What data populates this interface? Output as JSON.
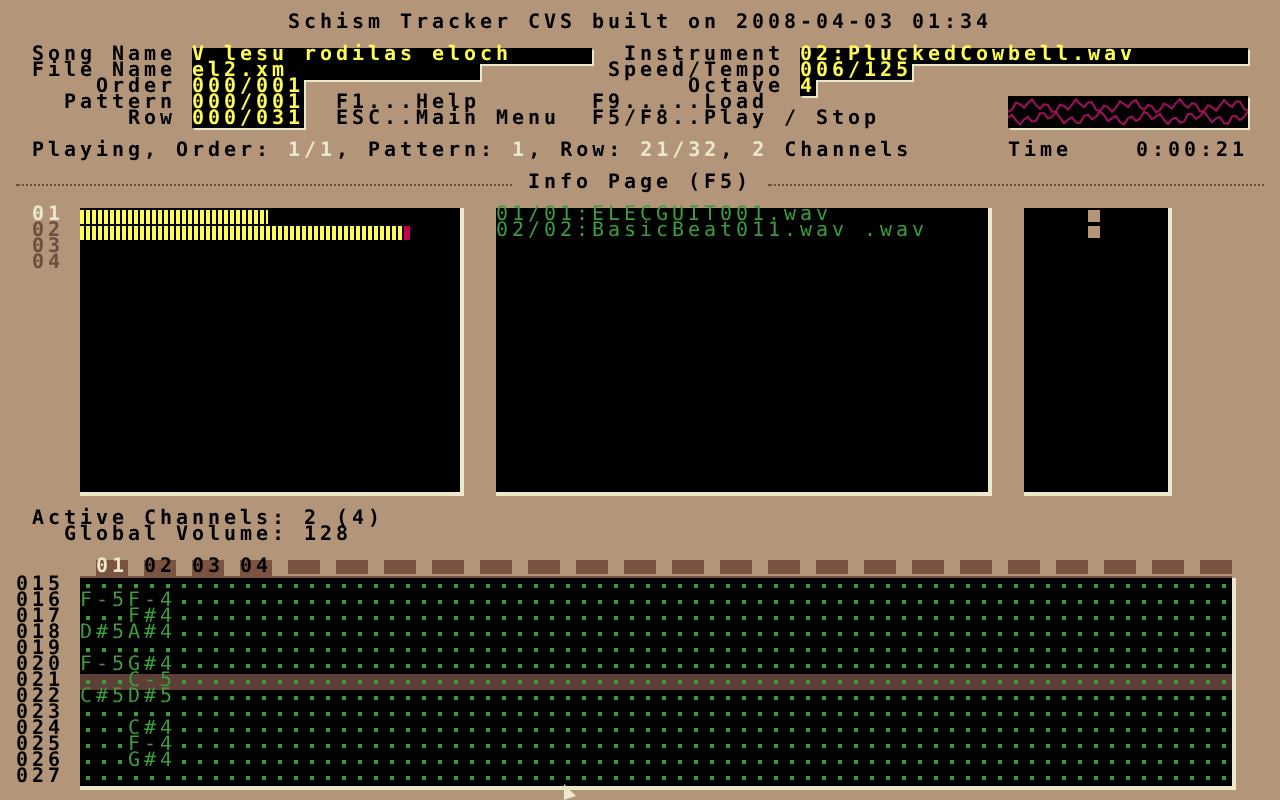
{
  "title": "Schism Tracker CVS built on 2008-04-03 01:34",
  "song_fields": [
    {
      "label": "Song Name",
      "value": "V lesu rodilas eloch"
    },
    {
      "label": "File Name",
      "value": "el2.xm"
    },
    {
      "label": "Order",
      "value": "000/001"
    },
    {
      "label": "Pattern",
      "value": "000/001"
    },
    {
      "label": "Row",
      "value": "000/031"
    }
  ],
  "instrument_fields": [
    {
      "label": "Instrument",
      "value": "02:PluckedCowbell.wav"
    },
    {
      "label": "Speed/Tempo",
      "value": "006/125"
    },
    {
      "label": "Octave",
      "value": "4"
    }
  ],
  "help_keys": [
    "F1...Help",
    "ESC..Main Menu",
    "F9.....Load",
    "F5/F8..Play / Stop"
  ],
  "status": {
    "segments": [
      {
        "text": "Playing, Order: ",
        "kind": "label"
      },
      {
        "text": "1/1",
        "kind": "value"
      },
      {
        "text": ", Pattern: ",
        "kind": "label"
      },
      {
        "text": "1",
        "kind": "value"
      },
      {
        "text": ", Row: ",
        "kind": "label"
      },
      {
        "text": "21/32",
        "kind": "value"
      },
      {
        "text": ", ",
        "kind": "label"
      },
      {
        "text": "2",
        "kind": "value"
      },
      {
        "text": " Channels",
        "kind": "label"
      }
    ],
    "time_label": "Time",
    "time": "0:00:21"
  },
  "section_title": "Info Page (F5)",
  "channels": [
    {
      "number": "01",
      "selected": true,
      "level": 0.5,
      "playing": true
    },
    {
      "number": "02",
      "selected": false,
      "level": 0.88,
      "playing": true
    },
    {
      "number": "03",
      "selected": false,
      "playing": false
    },
    {
      "number": "04",
      "selected": false,
      "playing": false
    }
  ],
  "samples": [
    "01/01:ELECGUIT001.wav",
    "02/02:BasicBeat011.wav .wav"
  ],
  "active_channels": "Active Channels: 2 (4)",
  "global_volume": "Global Volume: 128",
  "pattern": {
    "channel_tabs": [
      {
        "label": "01",
        "selected": true
      },
      {
        "label": "02",
        "selected": false
      },
      {
        "label": "03",
        "selected": false
      },
      {
        "label": "04",
        "selected": false
      }
    ],
    "rows": [
      {
        "number": "015",
        "current": false
      },
      {
        "number": "016",
        "current": false,
        "ch1": "F-5",
        "ch2": "F-4"
      },
      {
        "number": "017",
        "current": false,
        "ch2": "F#4"
      },
      {
        "number": "018",
        "current": false,
        "ch1": "D#5",
        "ch2": "A#4"
      },
      {
        "number": "019",
        "current": false
      },
      {
        "number": "020",
        "current": false,
        "ch1": "F-5",
        "ch2": "G#4"
      },
      {
        "number": "021",
        "current": true,
        "ch2": "C-5"
      },
      {
        "number": "022",
        "current": false,
        "ch1": "C#5",
        "ch2": "D#5"
      },
      {
        "number": "023",
        "current": false
      },
      {
        "number": "024",
        "current": false,
        "ch2": "C#4"
      },
      {
        "number": "025",
        "current": false,
        "ch2": "F-4"
      },
      {
        "number": "026",
        "current": false,
        "ch2": "G#4"
      },
      {
        "number": "027",
        "current": false
      }
    ]
  }
}
